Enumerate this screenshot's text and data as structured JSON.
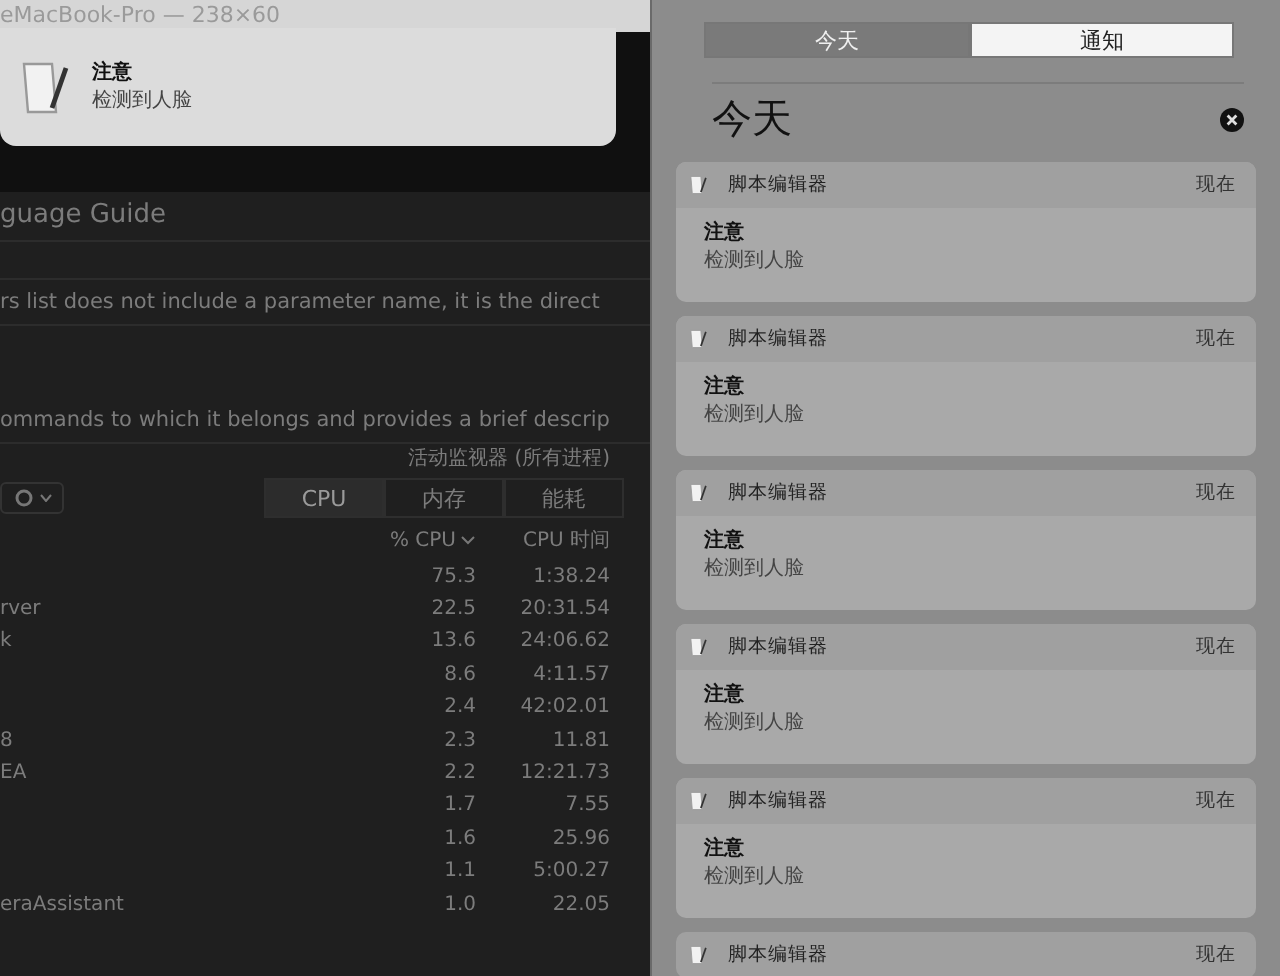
{
  "background_window": {
    "title": "eMacBook-Pro — 238×60",
    "heading": "guage Guide",
    "lines": [
      "rs list does not include a parameter name, it is the direct",
      "ommands to which it belongs and provides a brief descrip"
    ]
  },
  "activity_monitor": {
    "title": "活动监视器 (所有进程)",
    "tabs": [
      {
        "label": "CPU",
        "selected": true
      },
      {
        "label": "内存",
        "selected": false
      },
      {
        "label": "能耗",
        "selected": false
      }
    ],
    "columns": [
      {
        "label": "% CPU",
        "sorted": true
      },
      {
        "label": "CPU 时间",
        "sorted": false
      }
    ],
    "rows": [
      {
        "cpu": "75.3",
        "time": "1:38.24"
      },
      {
        "name": "rver",
        "cpu": "22.5",
        "time": "20:31.54"
      },
      {
        "name": "k",
        "cpu": "13.6",
        "time": "24:06.62"
      },
      {
        "cpu": "8.6",
        "time": "4:11.57"
      },
      {
        "cpu": "2.4",
        "time": "42:02.01"
      },
      {
        "name": "8",
        "cpu": "2.3",
        "time": "11.81"
      },
      {
        "name": "EA",
        "cpu": "2.2",
        "time": "12:21.73"
      },
      {
        "cpu": "1.7",
        "time": "7.55"
      },
      {
        "cpu": "1.6",
        "time": "25.96"
      },
      {
        "cpu": "1.1",
        "time": "5:00.27"
      },
      {
        "name": "eraAssistant",
        "cpu": "1.0",
        "time": "22.05"
      }
    ]
  },
  "banner": {
    "title": "注意",
    "message": "检测到人脸"
  },
  "notification_center": {
    "tabs": [
      {
        "label": "今天",
        "selected": false
      },
      {
        "label": "通知",
        "selected": true
      }
    ],
    "heading": "今天",
    "notifications": [
      {
        "app": "脚本编辑器",
        "time": "现在",
        "title": "注意",
        "message": "检测到人脸"
      },
      {
        "app": "脚本编辑器",
        "time": "现在",
        "title": "注意",
        "message": "检测到人脸"
      },
      {
        "app": "脚本编辑器",
        "time": "现在",
        "title": "注意",
        "message": "检测到人脸"
      },
      {
        "app": "脚本编辑器",
        "time": "现在",
        "title": "注意",
        "message": "检测到人脸"
      },
      {
        "app": "脚本编辑器",
        "time": "现在",
        "title": "注意",
        "message": "检测到人脸"
      },
      {
        "app": "脚本编辑器",
        "time": "现在"
      }
    ]
  }
}
